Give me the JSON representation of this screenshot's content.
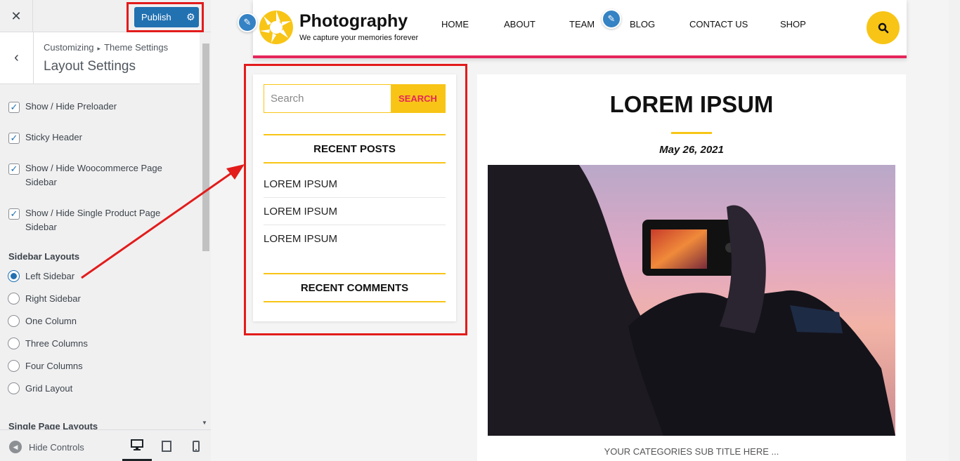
{
  "customizer": {
    "publish_label": "Publish",
    "breadcrumb_root": "Customizing",
    "breadcrumb_section": "Theme Settings",
    "section_title": "Layout Settings",
    "checkboxes": [
      {
        "label": "Show / Hide Preloader",
        "checked": true
      },
      {
        "label": "Sticky Header",
        "checked": true
      },
      {
        "label": "Show / Hide Woocommerce Page Sidebar",
        "checked": true
      },
      {
        "label": "Show / Hide Single Product Page Sidebar",
        "checked": true
      }
    ],
    "sidebar_layouts_title": "Sidebar Layouts",
    "sidebar_layouts": [
      {
        "label": "Left Sidebar",
        "selected": true
      },
      {
        "label": "Right Sidebar",
        "selected": false
      },
      {
        "label": "One Column",
        "selected": false
      },
      {
        "label": "Three Columns",
        "selected": false
      },
      {
        "label": "Four Columns",
        "selected": false
      },
      {
        "label": "Grid Layout",
        "selected": false
      }
    ],
    "single_page_layouts_title": "Single Page Layouts",
    "hide_controls_label": "Hide Controls",
    "accent_color": "#2271b1"
  },
  "site": {
    "title": "Photography",
    "tagline": "We capture your memories forever",
    "nav": [
      "HOME",
      "ABOUT",
      "TEAM",
      "BLOG",
      "CONTACT US",
      "SHOP"
    ],
    "brand_yellow": "#f8c516",
    "brand_pink": "#e5265a"
  },
  "sidebar": {
    "search_placeholder": "Search",
    "search_button": "SEARCH",
    "recent_posts_title": "RECENT POSTS",
    "recent_posts": [
      "LOREM IPSUM",
      "LOREM IPSUM",
      "LOREM IPSUM"
    ],
    "recent_comments_title": "RECENT COMMENTS"
  },
  "post": {
    "title": "LOREM IPSUM",
    "date": "May 26, 2021",
    "category_subtitle": "YOUR CATEGORIES SUB TITLE HERE ..."
  },
  "annotation_color": "#e31b1b"
}
